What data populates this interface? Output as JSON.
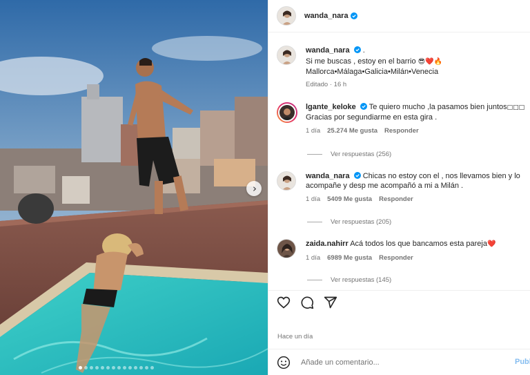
{
  "post": {
    "author": "wanda_nara",
    "caption_dot": ".",
    "caption_line1": "Si me buscas , estoy en el barrio",
    "caption_emojis": "😎❤️🔥",
    "caption_line2": "Mallorca•Málaga•Galicia•Milán•Venecia",
    "edited_time": "Editado · 16 h",
    "posted_ago": "Hace un día",
    "carousel_dots": 14,
    "carousel_active_index": 0
  },
  "comments": [
    {
      "user": "lgante_keloke",
      "verified": true,
      "text": "Te quiero mucho ,la pasamos bien juntos",
      "text_tail": "□□□",
      "text_line2": "Gracias por segundiarme en esta gira .",
      "time": "1 día",
      "likes": "25.274 Me gusta",
      "reply": "Responder",
      "view_replies": "Ver respuestas (256)"
    },
    {
      "user": "wanda_nara",
      "verified": true,
      "text": "Chicas no estoy con el , nos llevamos bien y lo acompañe y desp me acompañó a mi a Milán .",
      "time": "1 día",
      "likes": "5409 Me gusta",
      "reply": "Responder",
      "view_replies": "Ver respuestas (205)"
    },
    {
      "user": "zaida.nahirr",
      "verified": false,
      "text": "Acá todos los que bancamos esta pareja",
      "text_tail": "❤️",
      "time": "1 día",
      "likes": "6989 Me gusta",
      "reply": "Responder",
      "view_replies": "Ver respuestas (145)"
    }
  ],
  "composer": {
    "placeholder": "Añade un comentario...",
    "post_label": "Publicar"
  },
  "icons": {
    "like": "heart-icon",
    "comment": "comment-icon",
    "share": "send-icon",
    "emoji": "emoji-icon",
    "next": "chevron-right-icon",
    "verified": "verified-badge-icon"
  },
  "colors": {
    "verified_blue": "#0095f6",
    "post_button": "#85bdf0",
    "muted_text": "#737373"
  }
}
